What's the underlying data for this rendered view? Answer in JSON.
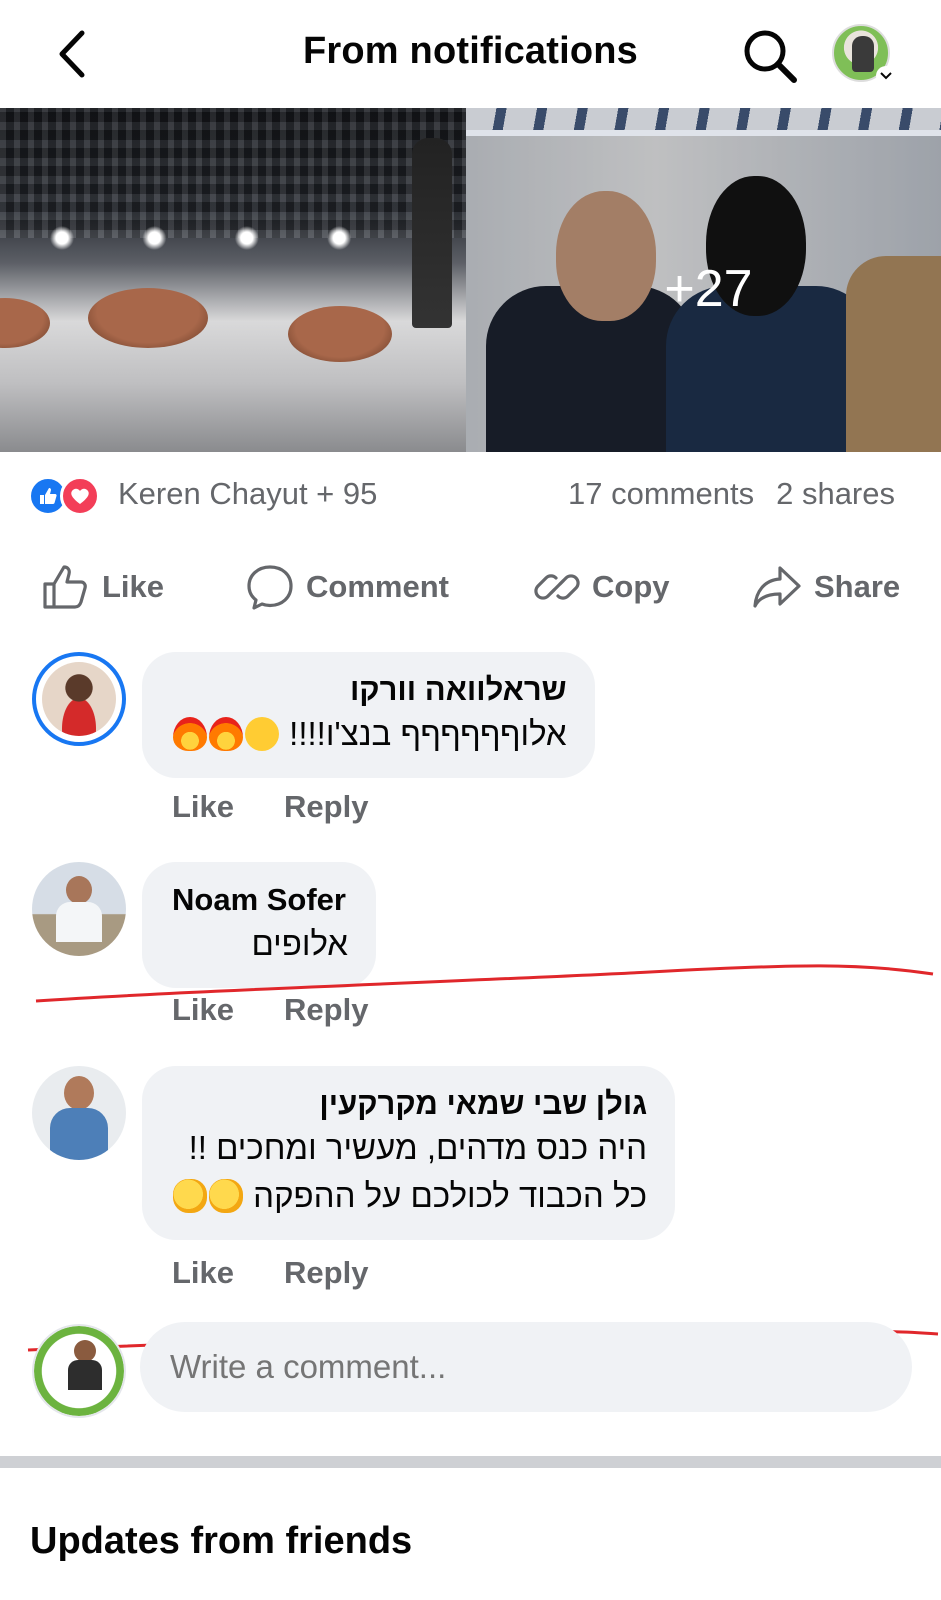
{
  "header": {
    "title": "From notifications",
    "back_icon": "chevron-left-icon",
    "search_icon": "search-icon"
  },
  "photos": {
    "more_count": "+27"
  },
  "reactions": {
    "names": "Keren Chayut + 95",
    "comments": "17 comments",
    "shares": "2 shares",
    "like_color": "#1877f2",
    "love_color": "#f33e58"
  },
  "actions": {
    "like": "Like",
    "comment": "Comment",
    "copy": "Copy",
    "share": "Share"
  },
  "comments": [
    {
      "author": "שראלוואה וורקו",
      "text": "אלוףףףףףף בנצ'ו!!!!",
      "like": "Like",
      "reply": "Reply"
    },
    {
      "author": "Noam Sofer",
      "text": "אלופים",
      "like": "Like",
      "reply": "Reply"
    },
    {
      "author": "גולן שבי שמאי מקרקעין",
      "text_line1": "היה כנס מדהים, מעשיר ומחכים !!",
      "text_line2": "כל הכבוד לכולכם על ההפקה",
      "like": "Like",
      "reply": "Reply"
    }
  ],
  "write_comment": {
    "placeholder": "Write a comment..."
  },
  "section": {
    "updates_title": "Updates from friends"
  },
  "colors": {
    "secondary_text": "#65676b",
    "bubble_bg": "#f0f2f5",
    "annotation_red": "#e0272b"
  }
}
